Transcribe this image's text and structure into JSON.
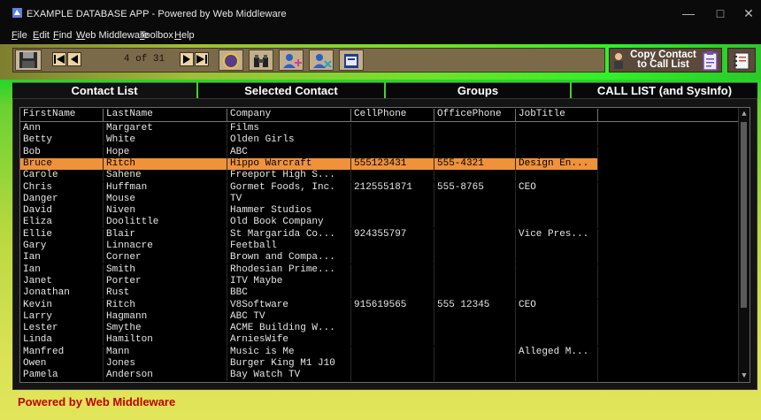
{
  "window": {
    "title": "EXAMPLE DATABASE APP - Powered by Web Middleware",
    "minimize": "—",
    "maximize": "□",
    "close": "✕"
  },
  "menu": [
    "File",
    "Edit",
    "Find",
    "Web Middleware",
    "Toolbox",
    "Help"
  ],
  "toolbar": {
    "record_counter": "4 of 31"
  },
  "copy_button": {
    "line1": "Copy Contact",
    "line2": "to Call List"
  },
  "tabs": [
    "Contact List",
    "Selected Contact",
    "Groups",
    "CALL LIST (and SysInfo)"
  ],
  "active_tab": 0,
  "grid": {
    "columns": [
      "FirstName",
      "LastName",
      "Company",
      "CellPhone",
      "OfficePhone",
      "JobTitle"
    ],
    "selected_row": 3,
    "rows": [
      [
        "Ann",
        "Margaret",
        "Films",
        "",
        "",
        ""
      ],
      [
        "Betty",
        "White",
        "Olden Girls",
        "",
        "",
        ""
      ],
      [
        "Bob",
        "Hope",
        "ABC",
        "",
        "",
        ""
      ],
      [
        "Bruce",
        "Ritch",
        "Hippo Warcraft",
        "555123431",
        "555-4321",
        "Design En..."
      ],
      [
        "Carole",
        "Sahene",
        "Freeport High S...",
        "",
        "",
        ""
      ],
      [
        "Chris",
        "Huffman",
        "Gormet Foods, Inc.",
        "2125551871",
        "555-8765",
        "CEO"
      ],
      [
        "Danger",
        "Mouse",
        "TV",
        "",
        "",
        ""
      ],
      [
        "David",
        "Niven",
        "Hammer Studios",
        "",
        "",
        ""
      ],
      [
        "Eliza",
        "Doolittle",
        "Old Book Company",
        "",
        "",
        ""
      ],
      [
        "Ellie",
        "Blair",
        "St Margarida Co...",
        "924355797",
        "",
        "Vice Pres..."
      ],
      [
        "Gary",
        "Linnacre",
        "Feetball",
        "",
        "",
        ""
      ],
      [
        "Ian",
        "Corner",
        "Brown and Compa...",
        "",
        "",
        ""
      ],
      [
        "Ian",
        "Smith",
        "Rhodesian Prime...",
        "",
        "",
        ""
      ],
      [
        "Janet",
        "Porter",
        "ITV Maybe",
        "",
        "",
        ""
      ],
      [
        "Jonathan",
        "Rust",
        "BBC",
        "",
        "",
        ""
      ],
      [
        "Kevin",
        "Ritch",
        "V8Software",
        "915619565",
        "555 12345",
        "CEO"
      ],
      [
        "Larry",
        "Hagmann",
        "ABC TV",
        "",
        "",
        ""
      ],
      [
        "Lester",
        "Smythe",
        "ACME Building W...",
        "",
        "",
        ""
      ],
      [
        "Linda",
        "Hamilton",
        "ArniesWife",
        "",
        "",
        ""
      ],
      [
        "Manfred",
        "Mann",
        "Music is Me",
        "",
        "",
        "Alleged M..."
      ],
      [
        "Owen",
        "Jones",
        "Burger King M1 J10",
        "",
        "",
        ""
      ],
      [
        "Pamela",
        "Anderson",
        "Bay Watch TV",
        "",
        "",
        ""
      ]
    ]
  },
  "footer": {
    "brand": "Powered by Web Middleware"
  },
  "colors": {
    "selection": "#f0923a",
    "brand_red": "#c00000",
    "toolbar": "#7a6a4a"
  }
}
